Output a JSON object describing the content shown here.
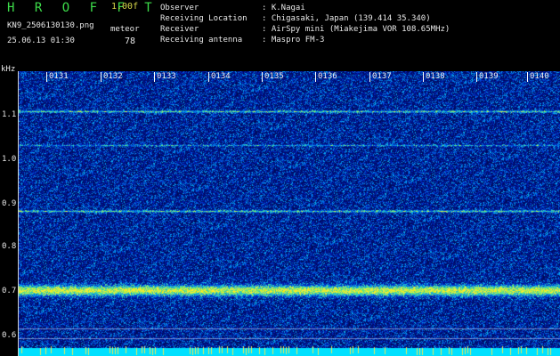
{
  "header": {
    "app_title": "HROFFT",
    "version": "1.00f",
    "filename": "KN9_2506130130.png",
    "datetime": "25.06.13 01:30",
    "meteor_label": "meteor",
    "meteor_count": "78"
  },
  "meta": {
    "observer_label": "Observer",
    "observer_value": ": K.Nagai",
    "location_label": "Receiving Location",
    "location_value": ": Chigasaki, Japan (139.414 35.340)",
    "receiver_label": "Receiver",
    "receiver_value": ": AirSpy mini (Miakejima VOR 108.65MHz)",
    "antenna_label": "Receiving antenna",
    "antenna_value": ": Maspro FM-3"
  },
  "y_axis": {
    "unit": "kHz",
    "ticks": [
      "1.1",
      "1.0",
      "0.9",
      "0.8",
      "0.7",
      "0.6"
    ]
  },
  "x_axis": {
    "ticks": [
      "0131",
      "0132",
      "0133",
      "0134",
      "0135",
      "0136",
      "0137",
      "0138",
      "0139",
      "0140"
    ]
  },
  "colors": {
    "background": "#000000",
    "plot_base": "#000a6e",
    "signal": "#a8f07a",
    "title_green": "#3ddc4a",
    "version_yellow": "#d8d84a",
    "bottom_band": "#00e0ff"
  }
}
